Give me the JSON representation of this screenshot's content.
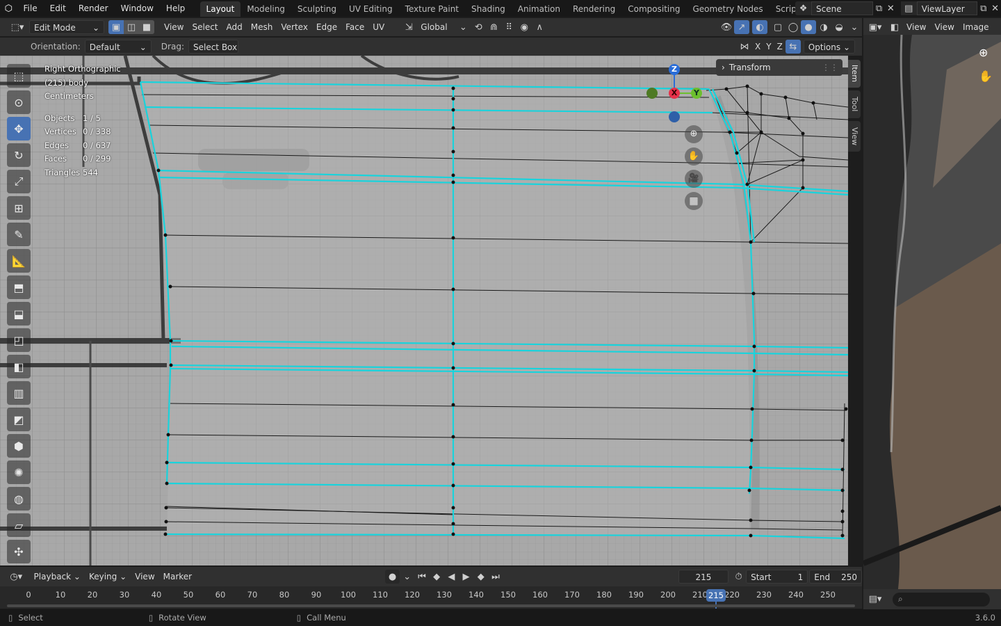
{
  "topbar": {
    "menus": [
      "File",
      "Edit",
      "Render",
      "Window",
      "Help"
    ],
    "workspaces": [
      "Layout",
      "Modeling",
      "Sculpting",
      "UV Editing",
      "Texture Paint",
      "Shading",
      "Animation",
      "Rendering",
      "Compositing",
      "Geometry Nodes",
      "Scripting"
    ],
    "active_workspace": "Layout",
    "scene": "Scene",
    "view_layer": "ViewLayer"
  },
  "header": {
    "mode": "Edit Mode",
    "menus": [
      "View",
      "Select",
      "Add",
      "Mesh",
      "Vertex",
      "Edge",
      "Face",
      "UV"
    ],
    "transform_orientation": "Global"
  },
  "tool_header": {
    "orientation_label": "Orientation:",
    "orientation_value": "Default",
    "drag_label": "Drag:",
    "drag_value": "Select Box",
    "axes": [
      "X",
      "Y",
      "Z"
    ],
    "options": "Options"
  },
  "viewport": {
    "view_name": "Right Orthographic",
    "object": "(215) body",
    "units": "Centimeters",
    "stats": [
      {
        "label": "Objects",
        "value": "1 / 5"
      },
      {
        "label": "Vertices",
        "value": "0 / 338"
      },
      {
        "label": "Edges",
        "value": "0 / 637"
      },
      {
        "label": "Faces",
        "value": "0 / 299"
      },
      {
        "label": "Triangles",
        "value": "544"
      }
    ],
    "panel_title": "Transform",
    "sidebar_tabs": [
      "Item",
      "Tool",
      "View"
    ],
    "gizmo_axes": [
      "Z",
      "X",
      "Y"
    ]
  },
  "image_editor": {
    "menus": [
      "View",
      "View",
      "Image"
    ]
  },
  "timeline": {
    "menus": [
      "Playback",
      "Keying",
      "View",
      "Marker"
    ],
    "current_frame": "215",
    "start_label": "Start",
    "start": "1",
    "end_label": "End",
    "end": "250",
    "ticks": [
      "0",
      "10",
      "20",
      "30",
      "40",
      "50",
      "60",
      "70",
      "80",
      "90",
      "100",
      "110",
      "120",
      "130",
      "140",
      "150",
      "160",
      "170",
      "180",
      "190",
      "200",
      "210",
      "220",
      "230",
      "240",
      "250"
    ],
    "playhead": "215"
  },
  "statusbar": {
    "items": [
      "Select",
      "Rotate View",
      "Call Menu"
    ],
    "version": "3.6.0"
  }
}
